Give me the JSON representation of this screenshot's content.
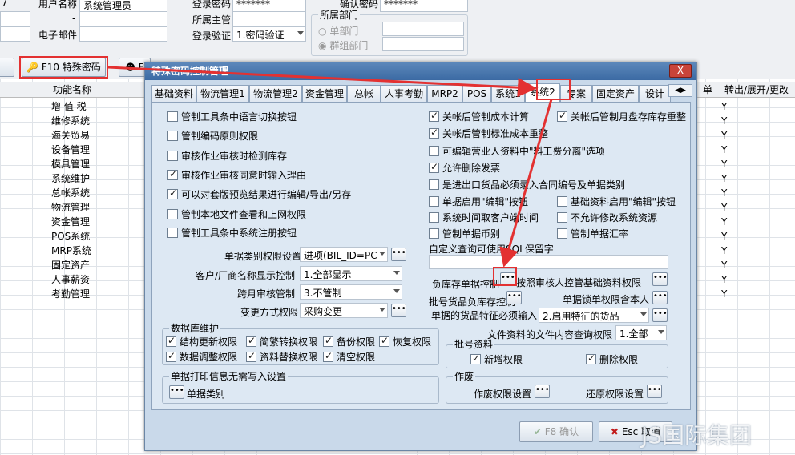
{
  "top_form": {
    "row1_left_value": "7",
    "user_name_label": "用户名称",
    "user_name_value": "系统管理员",
    "dash_label": "-",
    "email_label": "电子邮件",
    "login_pwd_label": "登录密码",
    "login_pwd_value": "*******",
    "supervisor_label": "所属主管",
    "login_verify_label": "登录验证",
    "login_verify_value": "1.密码验证",
    "confirm_pwd_label": "确认密码",
    "confirm_pwd_value": "*******",
    "dept_group_title": "所属部门",
    "single_dept_label": "单部门",
    "group_dept_label": "群组部门"
  },
  "toolbar": {
    "f10_label": "F10 特殊密码",
    "next_label": "F"
  },
  "grid": {
    "col_module": "功能名称",
    "col_single": "单",
    "col_transfer": "转出/展开/更改",
    "modules": [
      "增 值 税",
      "维修系统",
      "海关贸易",
      "设备管理",
      "模具管理",
      "系统维护",
      "总帐系统",
      "物流管理",
      "资金管理",
      "POS系统",
      "MRP系统",
      "固定资产",
      "人事薪资",
      "考勤管理"
    ],
    "y_values": [
      "Y",
      "Y",
      "Y",
      "Y",
      "Y",
      "Y",
      "Y",
      "Y",
      "Y",
      "Y",
      "Y",
      "Y",
      "Y",
      "Y"
    ]
  },
  "dialog": {
    "title": "特殊密码控制管理",
    "close_label": "X",
    "tabs": [
      "基础资料",
      "物流管理1",
      "物流管理2",
      "资金管理",
      "总帐",
      "人事考勤",
      "MRP2",
      "POS",
      "系统1",
      "系统2",
      "专案",
      "固定资产",
      "设计"
    ],
    "active_tab": "系统2",
    "left_checks": [
      {
        "label": "管制工具条中语言切换按钮",
        "checked": false
      },
      {
        "label": "管制编码原则权限",
        "checked": false
      },
      {
        "label": "审核作业审核时检测库存",
        "checked": false
      },
      {
        "label": "审核作业审核同意时输入理由",
        "checked": true
      },
      {
        "label": "可以对套版预览结果进行编辑/导出/另存",
        "checked": true
      },
      {
        "label": "管制本地文件查看和上网权限",
        "checked": false
      },
      {
        "label": "管制工具条中系统注册按钮",
        "checked": false
      }
    ],
    "doc_perm_label": "单据类别权限设置",
    "doc_perm_value": "进项(BIL_ID=PC",
    "cust_name_label": "客户/厂商名称显示控制",
    "cust_name_value": "1.全部显示",
    "cross_month_label": "跨月审核管制",
    "cross_month_value": "3.不管制",
    "change_method_label": "变更方式权限",
    "change_method_value": "采购变更",
    "right_checks_a": [
      {
        "label": "关帐后管制成本计算",
        "checked": true
      },
      {
        "label": "关帐后管制标准成本重整",
        "checked": true
      },
      {
        "label": "可编辑营业人资料中\"料工费分离\"选项",
        "checked": false
      },
      {
        "label": "允许删除发票",
        "checked": true
      },
      {
        "label": "是进出口货品必须录入合同编号及单据类别",
        "checked": false
      },
      {
        "label": "单据启用\"编辑\"按钮",
        "checked": false
      },
      {
        "label": "系统时间取客户端时间",
        "checked": false
      },
      {
        "label": "管制单据币别",
        "checked": false
      }
    ],
    "right_checks_b": [
      {
        "label": "关帐后管制月盘存库存重整",
        "checked": true
      },
      {
        "label": "基础资料启用\"编辑\"按钮",
        "checked": false
      },
      {
        "label": "不允许修改系统资源",
        "checked": false
      },
      {
        "label": "管制单据汇率",
        "checked": false
      }
    ],
    "custom_query_label": "自定义查询可使用SQL保留字",
    "neg_stock_label": "负库存单据控制",
    "audit_by_person_label": "按照审核人控管基础资料权限",
    "batch_neg_label": "批号货品负库存控制",
    "doc_lock_label": "单据锁单权限含本人",
    "feature_input_label": "单据的货品特征必须输入",
    "feature_input_value": "2.启用特征的货品",
    "file_query_label": "文件资料的文件内容查询权限",
    "file_query_value": "1.全部",
    "db_group_title": "数据库维护",
    "db_checks": [
      {
        "label": "结构更新权限",
        "checked": true
      },
      {
        "label": "简繁转换权限",
        "checked": true
      },
      {
        "label": "备份权限",
        "checked": true
      },
      {
        "label": "恢复权限",
        "checked": true
      },
      {
        "label": "数据调整权限",
        "checked": true
      },
      {
        "label": "资料替换权限",
        "checked": true
      },
      {
        "label": "清空权限",
        "checked": true
      }
    ],
    "batch_group_title": "批号资料",
    "batch_add_label": "新增权限",
    "batch_delete_label": "删除权限",
    "print_group_title": "单据打印信息无需写入设置",
    "print_doc_type_label": "单据类别",
    "void_group_title": "作废",
    "void_perm_label": "作废权限设置",
    "restore_perm_label": "还原权限设置",
    "ok_label": "F8 确认",
    "cancel_label": "Esc 取消"
  },
  "watermark": "JS国际集团",
  "colors": {
    "annotation_red": "#e33131",
    "title_bar": "#3b6aa3"
  }
}
